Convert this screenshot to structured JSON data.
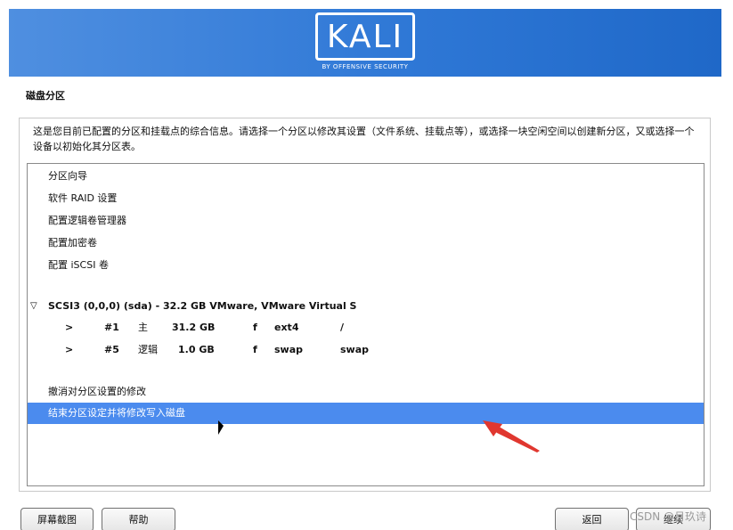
{
  "header": {
    "logo_text": "KALI",
    "logo_tagline": "BY OFFENSIVE SECURITY",
    "brand_color": "#2f78d6"
  },
  "page_title": "磁盘分区",
  "instructions": "这是您目前已配置的分区和挂载点的综合信息。请选择一个分区以修改其设置（文件系统、挂载点等），或选择一块空闲空间以创建新分区，又或选择一个设备以初始化其分区表。",
  "menu_items": [
    {
      "label": "分区向导"
    },
    {
      "label": "软件 RAID 设置"
    },
    {
      "label": "配置逻辑卷管理器"
    },
    {
      "label": "配置加密卷"
    },
    {
      "label": "配置 iSCSI 卷"
    }
  ],
  "disk": {
    "expand_icon": "triangle-down-icon",
    "label": "SCSI3 (0,0,0) (sda) - 32.2 GB VMware, VMware Virtual S"
  },
  "partitions": [
    {
      "arrow": ">",
      "number": "#1",
      "type": "主",
      "size": "31.2 GB",
      "flag": "f",
      "fs": "ext4",
      "mount": "/"
    },
    {
      "arrow": ">",
      "number": "#5",
      "type": "逻辑",
      "size": "1.0 GB",
      "flag": "f",
      "fs": "swap",
      "mount": "swap"
    }
  ],
  "actions": [
    {
      "label": "撤消对分区设置的修改",
      "selected": false
    },
    {
      "label": "结束分区设定并将修改写入磁盘",
      "selected": true
    }
  ],
  "selection_color": "#4b8bee",
  "buttons": {
    "screenshot": "屏幕截图",
    "help": "帮助",
    "back": "返回",
    "continue": "继续"
  },
  "watermark": "CSDN @月玖诗"
}
